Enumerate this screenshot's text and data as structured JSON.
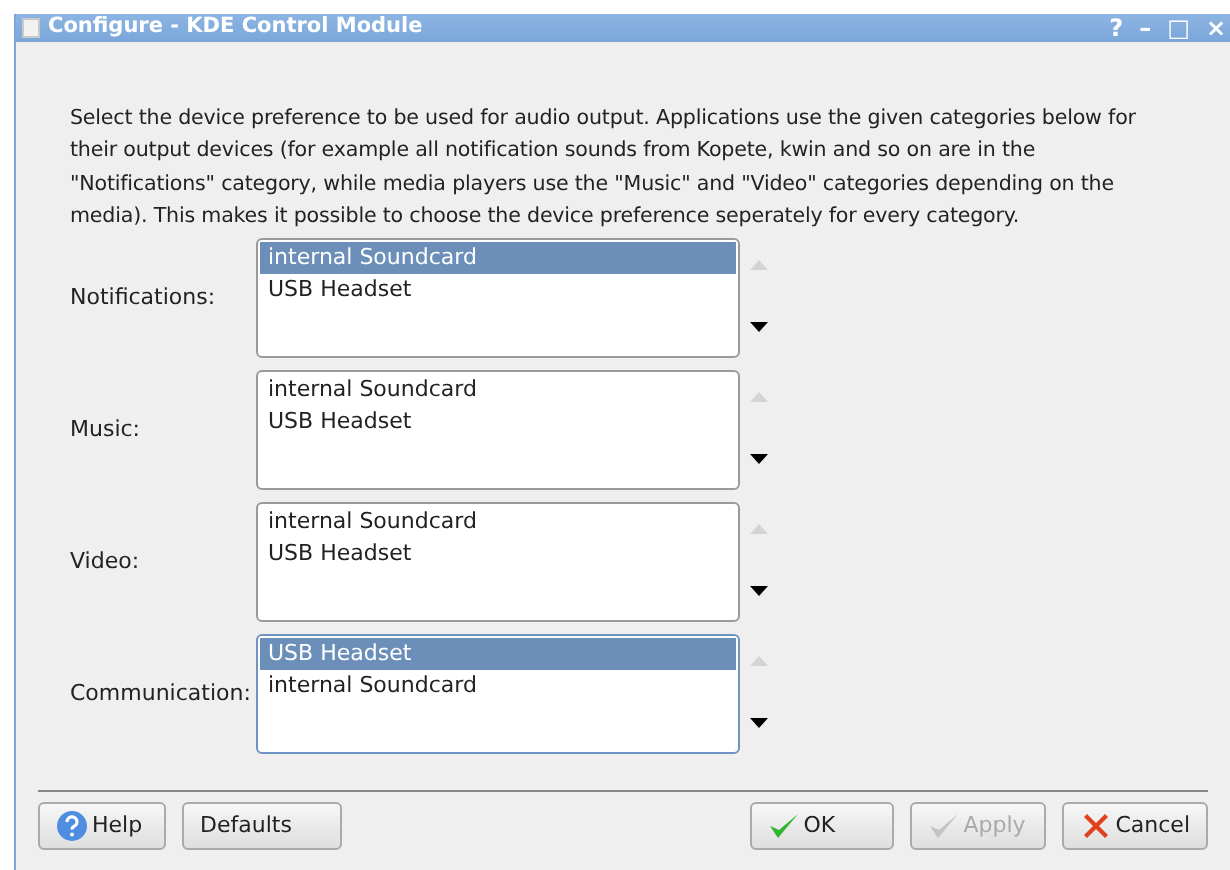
{
  "window": {
    "title": "Configure - KDE Control Module",
    "controls": [
      "?",
      "–",
      "□",
      "×"
    ]
  },
  "description": "Select the device preference to be used for audio output. Applications use the given categories below for their output devices (for example all notification sounds from Kopete, kwin and so on are in the \"Notifications\" category, while media players use the \"Music\" and \"Video\" categories depending on the media). This makes it possible to choose the device preference seperately for every category.",
  "categories": [
    {
      "label": "Notifications:",
      "focused": false,
      "up_disabled": true,
      "down_disabled": false,
      "devices": [
        {
          "name": "internal Soundcard",
          "selected": true
        },
        {
          "name": "USB Headset",
          "selected": false
        }
      ]
    },
    {
      "label": "Music:",
      "focused": false,
      "up_disabled": true,
      "down_disabled": false,
      "devices": [
        {
          "name": "internal Soundcard",
          "selected": false
        },
        {
          "name": "USB Headset",
          "selected": false
        }
      ]
    },
    {
      "label": "Video:",
      "focused": false,
      "up_disabled": true,
      "down_disabled": false,
      "devices": [
        {
          "name": "internal Soundcard",
          "selected": false
        },
        {
          "name": "USB Headset",
          "selected": false
        }
      ]
    },
    {
      "label": "Communication:",
      "focused": true,
      "up_disabled": true,
      "down_disabled": false,
      "devices": [
        {
          "name": "USB Headset",
          "selected": true
        },
        {
          "name": "internal Soundcard",
          "selected": false
        }
      ]
    }
  ],
  "buttons": [
    {
      "label": "Help",
      "kind": "help",
      "disabled": false
    },
    {
      "label": "Defaults",
      "kind": "plain",
      "disabled": false
    },
    {
      "label": "OK",
      "kind": "ok",
      "disabled": false
    },
    {
      "label": "Apply",
      "kind": "ok",
      "disabled": true
    },
    {
      "label": "Cancel",
      "kind": "cancel",
      "disabled": false
    }
  ]
}
